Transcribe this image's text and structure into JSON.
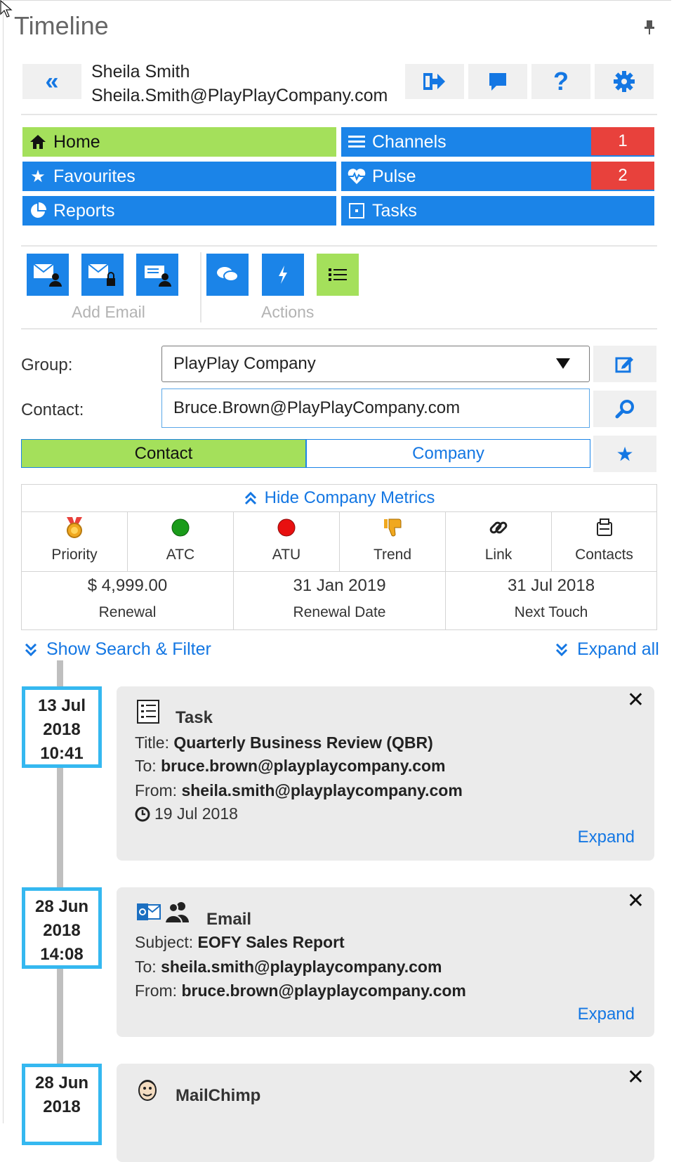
{
  "panel": {
    "title": "Timeline"
  },
  "user": {
    "name": "Sheila Smith",
    "email": "Sheila.Smith@PlayPlayCompany.com"
  },
  "header_buttons": [
    "back-icon",
    "logout-icon",
    "chat-icon",
    "help-icon",
    "settings-icon"
  ],
  "nav": {
    "home": "Home",
    "channels": "Channels",
    "channels_badge": "1",
    "favourites": "Favourites",
    "pulse": "Pulse",
    "pulse_badge": "2",
    "reports": "Reports",
    "tasks": "Tasks"
  },
  "toolbar": {
    "add_email_label": "Add Email",
    "actions_label": "Actions"
  },
  "form": {
    "group_label": "Group:",
    "group_value": "PlayPlay Company",
    "contact_label": "Contact:",
    "contact_value": "Bruce.Brown@PlayPlayCompany.com"
  },
  "toggle": {
    "contact": "Contact",
    "company": "Company",
    "active": "Contact"
  },
  "metrics": {
    "header": "Hide Company Metrics",
    "indicators": [
      {
        "label": "Priority",
        "icon": "medal-icon"
      },
      {
        "label": "ATC",
        "icon": "green-dot-icon"
      },
      {
        "label": "ATU",
        "icon": "red-dot-icon"
      },
      {
        "label": "Trend",
        "icon": "thumbs-down-icon"
      },
      {
        "label": "Link",
        "icon": "link-icon"
      },
      {
        "label": "Contacts",
        "icon": "contacts-icon"
      }
    ],
    "values": [
      {
        "value": "$ 4,999.00",
        "label": "Renewal"
      },
      {
        "value": "31 Jan 2019",
        "label": "Renewal Date"
      },
      {
        "value": "31 Jul 2018",
        "label": "Next Touch"
      }
    ]
  },
  "links": {
    "show_search": "Show Search & Filter",
    "expand_all": "Expand all"
  },
  "timeline": [
    {
      "date": {
        "day": "13 Jul",
        "year": "2018",
        "time": "10:41"
      },
      "type": "Task",
      "lines": [
        {
          "label": "Title: ",
          "value": "Quarterly Business Review (QBR)"
        },
        {
          "label": "To: ",
          "value": "bruce.brown@playplaycompany.com"
        },
        {
          "label": "From: ",
          "value": "sheila.smith@playplaycompany.com"
        }
      ],
      "due": "19 Jul 2018",
      "expand": "Expand"
    },
    {
      "date": {
        "day": "28 Jun",
        "year": "2018",
        "time": "14:08"
      },
      "type": "Email",
      "lines": [
        {
          "label": "Subject: ",
          "value": "EOFY Sales Report"
        },
        {
          "label": "To: ",
          "value": "sheila.smith@playplaycompany.com"
        },
        {
          "label": "From: ",
          "value": "bruce.brown@playplaycompany.com"
        }
      ],
      "expand": "Expand"
    },
    {
      "date": {
        "day": "28 Jun",
        "year": "2018"
      },
      "type": "MailChimp"
    }
  ],
  "colors": {
    "accent": "#1b84e8",
    "active": "#a4e05b",
    "badge": "#e8413c",
    "date_border": "#35b8f0"
  }
}
